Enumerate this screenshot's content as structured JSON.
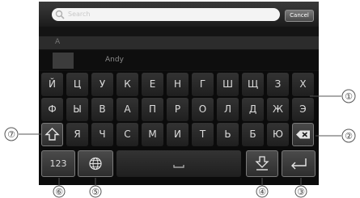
{
  "search": {
    "placeholder": "Search",
    "cancel_label": "Cancel"
  },
  "contacts": {
    "section_letter": "A",
    "items": [
      {
        "name": "Andy"
      }
    ]
  },
  "keyboard": {
    "rows": [
      [
        "Й",
        "Ц",
        "У",
        "К",
        "Е",
        "Н",
        "Г",
        "Ш",
        "Щ",
        "З",
        "Х"
      ],
      [
        "Ф",
        "Ы",
        "В",
        "А",
        "П",
        "Р",
        "О",
        "Л",
        "Д",
        "Ж",
        "Э"
      ],
      [
        "Я",
        "Ч",
        "С",
        "М",
        "И",
        "Т",
        "Ь",
        "Б",
        "Ю"
      ]
    ],
    "mode_key_label": "123",
    "icons": {
      "shift": "shift-icon",
      "backspace": "backspace-icon",
      "language": "globe-icon",
      "space": "space-bar-icon",
      "hide": "hide-keyboard-icon",
      "enter": "enter-icon"
    }
  },
  "callouts": [
    "①",
    "②",
    "③",
    "④",
    "⑤",
    "⑥",
    "⑦"
  ]
}
